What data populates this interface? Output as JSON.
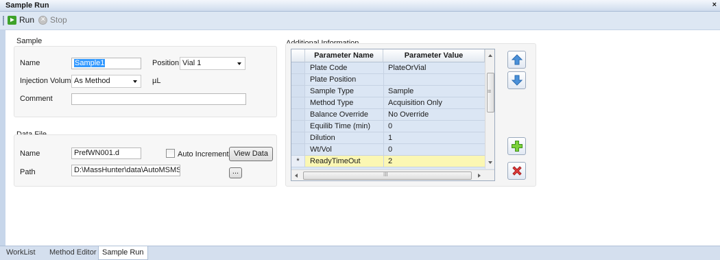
{
  "window": {
    "title": "Sample Run",
    "close": "×"
  },
  "toolbar": {
    "run": "Run",
    "stop": "Stop"
  },
  "sample": {
    "group_label": "Sample",
    "name_label": "Name",
    "name_value": "Sample1",
    "position_label": "Position",
    "position_value": "Vial 1",
    "injection_label": "Injection Volume",
    "injection_value": "As Method",
    "injection_unit": "µL",
    "comment_label": "Comment",
    "comment_value": ""
  },
  "datafile": {
    "group_label": "Data File",
    "name_label": "Name",
    "name_value": "PrefWN001.d",
    "auto_increment_label": "Auto Increment",
    "auto_increment_checked": false,
    "view_data": "View Data",
    "path_label": "Path",
    "path_value": "D:\\MassHunter\\data\\AutoMSMS",
    "browse": "..."
  },
  "additional": {
    "label": "Additional Information",
    "col_name": "Parameter Name",
    "col_value": "Parameter Value",
    "rows": [
      {
        "name": "Plate Code",
        "value": "PlateOrVial"
      },
      {
        "name": "Plate Position",
        "value": ""
      },
      {
        "name": "Sample Type",
        "value": "Sample"
      },
      {
        "name": "Method Type",
        "value": "Acquisition Only"
      },
      {
        "name": "Balance Override",
        "value": "No Override"
      },
      {
        "name": "Equilib Time (min)",
        "value": "0"
      },
      {
        "name": "Dilution",
        "value": "1"
      },
      {
        "name": "Wt/Vol",
        "value": "0"
      }
    ],
    "new_row": {
      "marker": "*",
      "name": "ReadyTimeOut",
      "value": "2"
    },
    "hscroll_grip": "III",
    "vscroll_grip": "≡"
  },
  "side_buttons": [
    "move-up-icon",
    "move-down-icon",
    "add-icon",
    "delete-icon"
  ],
  "tabs": [
    "WorkList",
    "Method Editor",
    "Sample Run"
  ],
  "active_tab": "Sample Run",
  "colors": {
    "accent_blue": "#3399ff",
    "grid_blue": "#dbe6f4",
    "new_row_yellow": "#fbf7b3",
    "run_green": "#3ea22a",
    "delete_red": "#d92020"
  }
}
